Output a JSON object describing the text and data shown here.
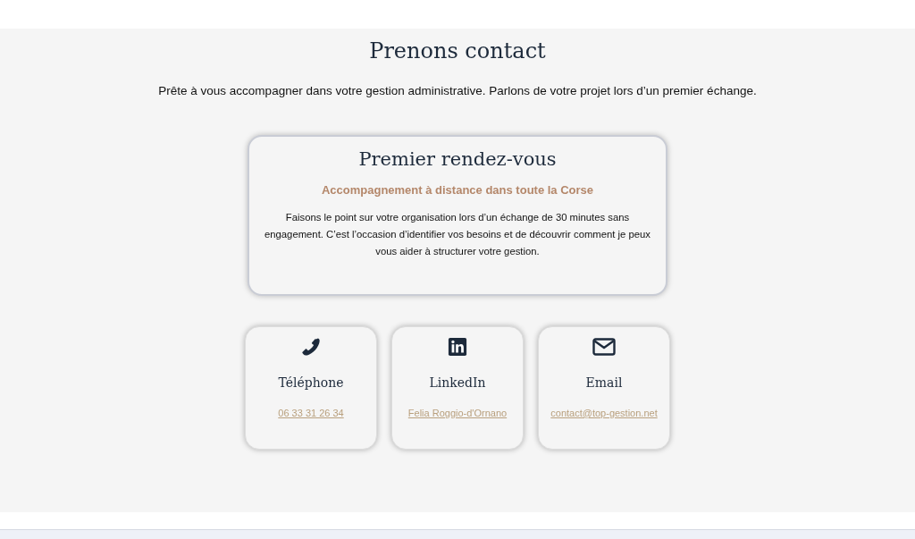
{
  "section": {
    "title": "Prenons contact",
    "intro": "Prête à vous accompagner dans votre gestion administrative. Parlons de votre projet lors d’un premier échange."
  },
  "meeting_card": {
    "title": "Premier rendez-vous",
    "subtitle": "Accompagnement à distance dans toute la Corse",
    "text": "Faisons le point sur votre organisation lors d’un échange de 30 minutes sans engagement. C’est l’occasion d’identifier vos besoins et de découvrir comment je peux vous aider à structurer votre gestion."
  },
  "contacts": [
    {
      "kind": "phone",
      "title": "Téléphone",
      "link": "06 33 31 26 34"
    },
    {
      "kind": "linkedin",
      "title": "LinkedIn",
      "link": "Felia Roggio-d'Ornano"
    },
    {
      "kind": "email",
      "title": "Email",
      "link": "contact@top-gestion.net"
    }
  ]
}
